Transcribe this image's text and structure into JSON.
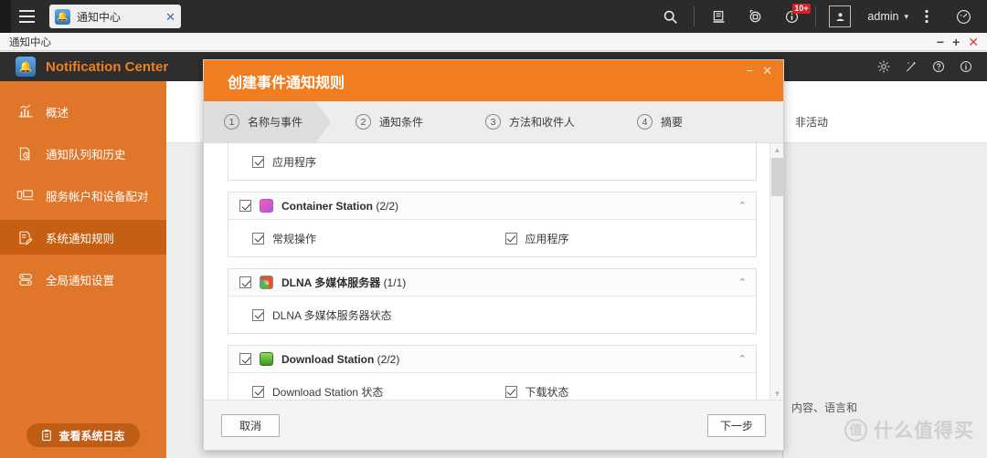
{
  "desktop": {
    "menu_icon": "hamburger-icon",
    "tab": {
      "title": "通知中心",
      "icon": "notification-app-icon",
      "close": "✕"
    },
    "toolbar": {
      "search_icon": "search-icon",
      "backup_icon": "backup-icon",
      "resource_icon": "resource-monitor-icon",
      "info_icon": "info-icon",
      "info_badge": "10+",
      "user_icon": "user-avatar-icon",
      "username": "admin",
      "caret": "▾",
      "more_icon": "more-vertical-icon",
      "dashboard_icon": "dashboard-gauge-icon"
    }
  },
  "window": {
    "title": "通知中心",
    "minimize": "−",
    "maximize": "+",
    "close": "✕"
  },
  "app": {
    "name": "Notification Center",
    "logo_icon": "notification-bell-gear-icon",
    "header_icons": [
      "settings-gear-icon",
      "wizard-wand-icon",
      "help-question-icon",
      "about-info-icon"
    ]
  },
  "sidebar": {
    "items": [
      {
        "label": "概述",
        "icon": "chart-bars-icon",
        "active": false
      },
      {
        "label": "通知队列和历史",
        "icon": "history-queue-icon",
        "active": false
      },
      {
        "label": "服务帐户和设备配对",
        "icon": "device-pair-icon",
        "active": false
      },
      {
        "label": "系统通知规则",
        "icon": "rules-edit-icon",
        "active": true
      },
      {
        "label": "全局通知设置",
        "icon": "global-settings-icon",
        "active": false
      }
    ],
    "log_button": {
      "label": "查看系统日志",
      "icon": "clipboard-log-icon"
    }
  },
  "background": {
    "column_header": "非活动",
    "text_fragment": "法、内容、语言和"
  },
  "watermark": {
    "badge": "值",
    "text": "什么值得买"
  },
  "modal": {
    "title": "创建事件通知规则",
    "minimize": "−",
    "close": "✕",
    "steps": [
      {
        "num": "1",
        "label": "名称与事件",
        "active": true
      },
      {
        "num": "2",
        "label": "通知条件",
        "active": false
      },
      {
        "num": "3",
        "label": "方法和收件人",
        "active": false
      },
      {
        "num": "4",
        "label": "摘要",
        "active": false
      }
    ],
    "partial_top_item": {
      "label": "应用程序",
      "checked": true
    },
    "groups": [
      {
        "title": "Container Station",
        "count": "(2/2)",
        "icon": "container-station-icon",
        "icon_color": "#e8529e",
        "checked": true,
        "expanded": true,
        "chevron": "⌃",
        "items": [
          {
            "label": "常规操作",
            "checked": true
          },
          {
            "label": "应用程序",
            "checked": true
          }
        ]
      },
      {
        "title": "DLNA 多媒体服务器",
        "count": "(1/1)",
        "icon": "dlna-media-server-icon",
        "icon_color": "#4aa3df",
        "checked": true,
        "expanded": true,
        "chevron": "⌃",
        "items": [
          {
            "label": "DLNA 多媒体服务器状态",
            "checked": true
          }
        ]
      },
      {
        "title": "Download Station",
        "count": "(2/2)",
        "icon": "download-station-icon",
        "icon_color": "#5cb030",
        "checked": true,
        "expanded": true,
        "chevron": "⌃",
        "items": [
          {
            "label": "Download Station 状态",
            "checked": true
          },
          {
            "label": "下载状态",
            "checked": true
          }
        ]
      }
    ],
    "scrollbar": {
      "up": "▲",
      "down": "▼"
    },
    "buttons": {
      "cancel": "取消",
      "next": "下一步"
    }
  },
  "colors": {
    "brand_orange": "#f07d20",
    "sidebar_orange": "#e0762a",
    "sidebar_active": "#c75f12",
    "dark_chrome": "#2e2e2e",
    "badge_red": "#d81f28"
  }
}
